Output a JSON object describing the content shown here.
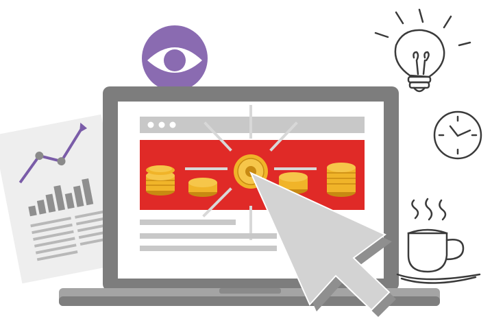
{
  "illustration": {
    "colors": {
      "laptop_frame": "#7d7d7d",
      "laptop_frame_dark": "#555555",
      "laptop_base": "#9a9a9a",
      "screen_bg": "#ffffff",
      "browser_bar": "#c8c8c8",
      "banner_red": "#e02a27",
      "coin_gold": "#f0b429",
      "coin_dark": "#c88a12",
      "eye_purple": "#8a6bb1",
      "chart_line": "#7a5ca8",
      "paper_bg": "#eeeeee",
      "cursor_fill": "#d3d3d3",
      "cursor_shadow": "#8f8f8f"
    },
    "icons": {
      "eye": "eye-icon",
      "lightbulb": "lightbulb-icon",
      "clock": "clock-icon",
      "coffee": "coffee-cup-icon",
      "cursor": "mouse-cursor-icon",
      "coin": "coin-icon",
      "chart": "line-chart-icon"
    },
    "browser": {
      "window_dots": 3
    }
  }
}
